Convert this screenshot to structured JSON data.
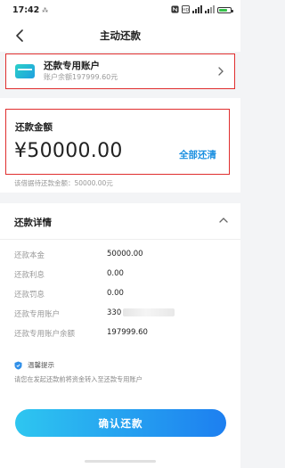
{
  "status_bar": {
    "time": "17:42",
    "time_extra": "⁂",
    "icons": [
      "nfc-icon",
      "hd-icon",
      "signal-icon-1",
      "signal-icon-2",
      "battery-icon"
    ]
  },
  "nav": {
    "title": "主动还款",
    "back_icon": "back-arrow-icon"
  },
  "account": {
    "title": "还款专用账户",
    "balance": "账户余额197999.60元",
    "icon": "card-icon"
  },
  "amount": {
    "label": "还款金额",
    "value": "¥50000.00",
    "pay_all": "全部还清",
    "note": "该借据待还款金额：50000.00元"
  },
  "details": {
    "title": "还款详情",
    "rows": [
      {
        "label": "还款本金",
        "value": "50000.00"
      },
      {
        "label": "还款利息",
        "value": "0.00"
      },
      {
        "label": "还款罚息",
        "value": "0.00"
      },
      {
        "label": "还款专用账户",
        "value": "330"
      },
      {
        "label": "还款专用账户余额",
        "value": "197999.60"
      }
    ]
  },
  "tip": {
    "title": "温馨提示",
    "text": "请您在发起还款前将资金转入至还款专用账户"
  },
  "confirm_button": {
    "label": "确认还款"
  },
  "colors": {
    "accent": "#1a8fe0",
    "highlight_border": "#e02e2e",
    "button_gradient_start": "#2ec6f0",
    "button_gradient_end": "#1d7ff0"
  }
}
